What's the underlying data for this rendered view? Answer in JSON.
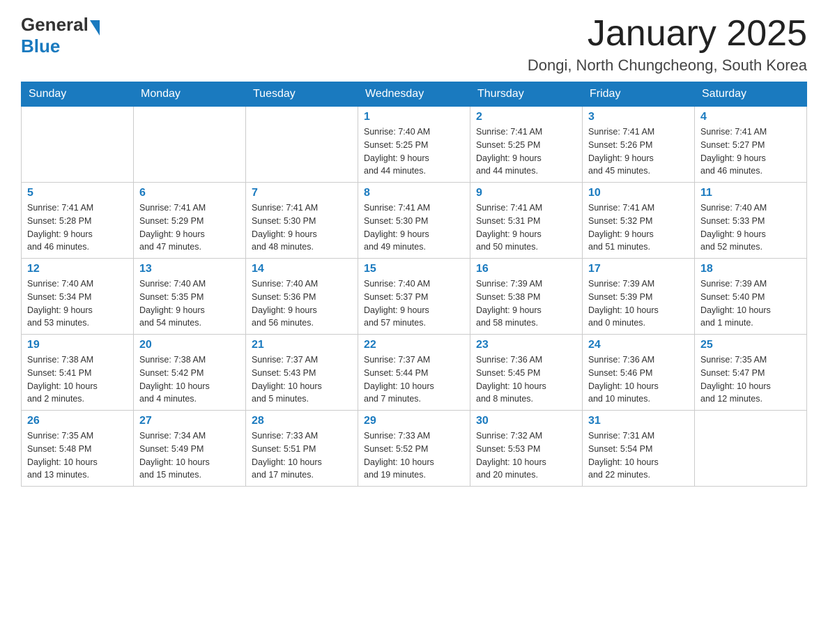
{
  "header": {
    "logo_general": "General",
    "logo_blue": "Blue",
    "month_title": "January 2025",
    "location": "Dongi, North Chungcheong, South Korea"
  },
  "days_of_week": [
    "Sunday",
    "Monday",
    "Tuesday",
    "Wednesday",
    "Thursday",
    "Friday",
    "Saturday"
  ],
  "weeks": [
    [
      {
        "day": "",
        "info": ""
      },
      {
        "day": "",
        "info": ""
      },
      {
        "day": "",
        "info": ""
      },
      {
        "day": "1",
        "info": "Sunrise: 7:40 AM\nSunset: 5:25 PM\nDaylight: 9 hours\nand 44 minutes."
      },
      {
        "day": "2",
        "info": "Sunrise: 7:41 AM\nSunset: 5:25 PM\nDaylight: 9 hours\nand 44 minutes."
      },
      {
        "day": "3",
        "info": "Sunrise: 7:41 AM\nSunset: 5:26 PM\nDaylight: 9 hours\nand 45 minutes."
      },
      {
        "day": "4",
        "info": "Sunrise: 7:41 AM\nSunset: 5:27 PM\nDaylight: 9 hours\nand 46 minutes."
      }
    ],
    [
      {
        "day": "5",
        "info": "Sunrise: 7:41 AM\nSunset: 5:28 PM\nDaylight: 9 hours\nand 46 minutes."
      },
      {
        "day": "6",
        "info": "Sunrise: 7:41 AM\nSunset: 5:29 PM\nDaylight: 9 hours\nand 47 minutes."
      },
      {
        "day": "7",
        "info": "Sunrise: 7:41 AM\nSunset: 5:30 PM\nDaylight: 9 hours\nand 48 minutes."
      },
      {
        "day": "8",
        "info": "Sunrise: 7:41 AM\nSunset: 5:30 PM\nDaylight: 9 hours\nand 49 minutes."
      },
      {
        "day": "9",
        "info": "Sunrise: 7:41 AM\nSunset: 5:31 PM\nDaylight: 9 hours\nand 50 minutes."
      },
      {
        "day": "10",
        "info": "Sunrise: 7:41 AM\nSunset: 5:32 PM\nDaylight: 9 hours\nand 51 minutes."
      },
      {
        "day": "11",
        "info": "Sunrise: 7:40 AM\nSunset: 5:33 PM\nDaylight: 9 hours\nand 52 minutes."
      }
    ],
    [
      {
        "day": "12",
        "info": "Sunrise: 7:40 AM\nSunset: 5:34 PM\nDaylight: 9 hours\nand 53 minutes."
      },
      {
        "day": "13",
        "info": "Sunrise: 7:40 AM\nSunset: 5:35 PM\nDaylight: 9 hours\nand 54 minutes."
      },
      {
        "day": "14",
        "info": "Sunrise: 7:40 AM\nSunset: 5:36 PM\nDaylight: 9 hours\nand 56 minutes."
      },
      {
        "day": "15",
        "info": "Sunrise: 7:40 AM\nSunset: 5:37 PM\nDaylight: 9 hours\nand 57 minutes."
      },
      {
        "day": "16",
        "info": "Sunrise: 7:39 AM\nSunset: 5:38 PM\nDaylight: 9 hours\nand 58 minutes."
      },
      {
        "day": "17",
        "info": "Sunrise: 7:39 AM\nSunset: 5:39 PM\nDaylight: 10 hours\nand 0 minutes."
      },
      {
        "day": "18",
        "info": "Sunrise: 7:39 AM\nSunset: 5:40 PM\nDaylight: 10 hours\nand 1 minute."
      }
    ],
    [
      {
        "day": "19",
        "info": "Sunrise: 7:38 AM\nSunset: 5:41 PM\nDaylight: 10 hours\nand 2 minutes."
      },
      {
        "day": "20",
        "info": "Sunrise: 7:38 AM\nSunset: 5:42 PM\nDaylight: 10 hours\nand 4 minutes."
      },
      {
        "day": "21",
        "info": "Sunrise: 7:37 AM\nSunset: 5:43 PM\nDaylight: 10 hours\nand 5 minutes."
      },
      {
        "day": "22",
        "info": "Sunrise: 7:37 AM\nSunset: 5:44 PM\nDaylight: 10 hours\nand 7 minutes."
      },
      {
        "day": "23",
        "info": "Sunrise: 7:36 AM\nSunset: 5:45 PM\nDaylight: 10 hours\nand 8 minutes."
      },
      {
        "day": "24",
        "info": "Sunrise: 7:36 AM\nSunset: 5:46 PM\nDaylight: 10 hours\nand 10 minutes."
      },
      {
        "day": "25",
        "info": "Sunrise: 7:35 AM\nSunset: 5:47 PM\nDaylight: 10 hours\nand 12 minutes."
      }
    ],
    [
      {
        "day": "26",
        "info": "Sunrise: 7:35 AM\nSunset: 5:48 PM\nDaylight: 10 hours\nand 13 minutes."
      },
      {
        "day": "27",
        "info": "Sunrise: 7:34 AM\nSunset: 5:49 PM\nDaylight: 10 hours\nand 15 minutes."
      },
      {
        "day": "28",
        "info": "Sunrise: 7:33 AM\nSunset: 5:51 PM\nDaylight: 10 hours\nand 17 minutes."
      },
      {
        "day": "29",
        "info": "Sunrise: 7:33 AM\nSunset: 5:52 PM\nDaylight: 10 hours\nand 19 minutes."
      },
      {
        "day": "30",
        "info": "Sunrise: 7:32 AM\nSunset: 5:53 PM\nDaylight: 10 hours\nand 20 minutes."
      },
      {
        "day": "31",
        "info": "Sunrise: 7:31 AM\nSunset: 5:54 PM\nDaylight: 10 hours\nand 22 minutes."
      },
      {
        "day": "",
        "info": ""
      }
    ]
  ]
}
